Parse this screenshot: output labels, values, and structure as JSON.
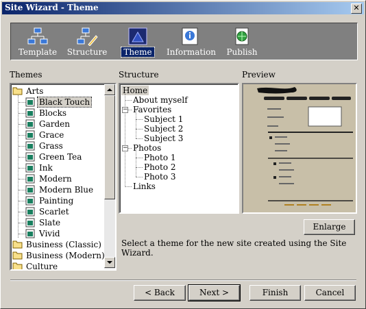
{
  "window": {
    "title": "Site Wizard - Theme",
    "close_glyph": "✕"
  },
  "toolbar": {
    "items": [
      {
        "label": "Template",
        "icon": "template-icon",
        "active": false
      },
      {
        "label": "Structure",
        "icon": "structure-icon",
        "active": false
      },
      {
        "label": "Theme",
        "icon": "theme-icon",
        "active": true
      },
      {
        "label": "Information",
        "icon": "information-icon",
        "active": false
      },
      {
        "label": "Publish",
        "icon": "publish-icon",
        "active": false
      }
    ]
  },
  "themes": {
    "heading": "Themes",
    "group_open": "Arts",
    "items": [
      "Black Touch",
      "Blocks",
      "Garden",
      "Grace",
      "Grass",
      "Green Tea",
      "Ink",
      "Modern",
      "Modern Blue",
      "Painting",
      "Scarlet",
      "Slate",
      "Vivid"
    ],
    "selected": "Black Touch",
    "other_groups": [
      "Business (Classic)",
      "Business (Modern)",
      "Culture"
    ]
  },
  "structure": {
    "heading": "Structure",
    "root": "Home",
    "nodes": [
      {
        "label": "About myself",
        "level": 1
      },
      {
        "label": "Favorites",
        "level": 1,
        "expander": "−"
      },
      {
        "label": "Subject 1",
        "level": 2
      },
      {
        "label": "Subject 2",
        "level": 2
      },
      {
        "label": "Subject 3",
        "level": 2
      },
      {
        "label": "Photos",
        "level": 1,
        "expander": "−"
      },
      {
        "label": "Photo 1",
        "level": 2
      },
      {
        "label": "Photo 2",
        "level": 2
      },
      {
        "label": "Photo 3",
        "level": 2
      },
      {
        "label": "Links",
        "level": 1
      }
    ]
  },
  "preview": {
    "heading": "Preview",
    "enlarge_label": "Enlarge"
  },
  "hint_text": "Select a theme for the new site created using the Site Wizard.",
  "footer": {
    "back": "< Back",
    "next": "Next >",
    "finish": "Finish",
    "cancel": "Cancel"
  },
  "colors": {
    "titlebar": "#0a246a",
    "face": "#d4d0c8",
    "toolbar": "#808080",
    "preview_bg": "#c8bfa8"
  }
}
